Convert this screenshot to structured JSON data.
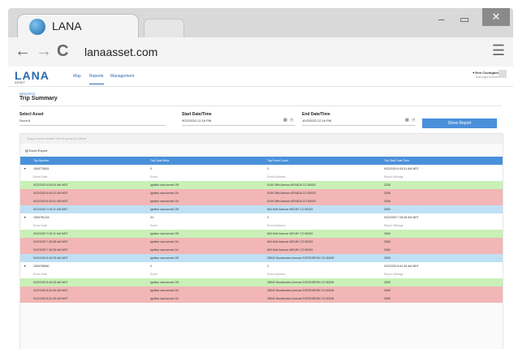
{
  "browser": {
    "tab_title": "LANA",
    "url": "lanaasset.com",
    "min": "–",
    "restore": "▭",
    "close": "✕",
    "back": "←",
    "forward": "→",
    "reload": "C",
    "menu": "☰"
  },
  "app": {
    "logo": "LANA",
    "logo_sub": "ASSET",
    "nav": [
      "Map",
      "Reports",
      "Management"
    ],
    "user_name": "▾ Erin Covington",
    "user_sub": "Manager/Admin"
  },
  "breadcrumb": "REPORTS",
  "page_title": "Trip Summary",
  "filters": {
    "asset_label": "Select Asset",
    "asset_value": "Drum A",
    "start_label": "Start Date/Time",
    "start_value": "9/22/2020 12:16 PM",
    "end_label": "End Date/Time",
    "end_value": "10/2/2020 12:16 PM",
    "show_button": "Show Report",
    "calendar_icon": "▦",
    "clock_icon": "◷"
  },
  "grid": {
    "group_hint": "Drag a column header here to group by column",
    "excel_label": "Excel Export",
    "headers": [
      "Trip Number",
      "Trip Total Miles",
      "Trip Event Count",
      "Trip Start Date Time"
    ],
    "sub_headers": [
      "Event Date",
      "Event",
      "Event Address",
      "Report Mileage"
    ],
    "trips": [
      {
        "number": "1500778631",
        "miles": "0",
        "count": "2",
        "start": "9/22/2020 6:43:31 AM MDT",
        "events": [
          {
            "date": "9/22/2020 6:00:00 AM MDT",
            "event": "Ignition was turned Off",
            "address": "5159 39th Avenue ARVADA CO 80003",
            "mileage": "3336",
            "status": "green"
          },
          {
            "date": "9/22/2020 6:43:31 AM MDT",
            "event": "Ignition was turned On",
            "address": "5159 39th Avenue ARVADA CO 80003",
            "mileage": "3336",
            "status": "red"
          },
          {
            "date": "9/22/2020 6:43:51 AM MDT",
            "event": "Ignition was turned On",
            "address": "5159 39th Avenue ARVADA CO 80003",
            "mileage": "3336",
            "status": "red"
          },
          {
            "date": "9/22/2020 7:03:11 AM MDT",
            "event": "Ignition was turned Off",
            "address": "663 64th Avenue WELBY CO 80229",
            "mileage": "3363",
            "status": "blue"
          }
        ]
      },
      {
        "number": "1500781215",
        "miles": "34",
        "count": "2",
        "start": "9/22/2020 7:28:35 AM MDT",
        "events": [
          {
            "date": "9/22/2020 7:03:11 AM MDT",
            "event": "Ignition was turned Off",
            "address": "663 64th Avenue WELBY CO 80229",
            "mileage": "3363",
            "status": "green"
          },
          {
            "date": "9/22/2020 7:28:35 AM MDT",
            "event": "Ignition was turned On",
            "address": "663 64th Avenue WELBY CO 80229",
            "mileage": "3363",
            "status": "red"
          },
          {
            "date": "9/22/2020 7:28:35 AM MDT",
            "event": "Ignition was turned On",
            "address": "663 64th Avenue WELBY CO 80229",
            "mileage": "3363",
            "status": "red"
          },
          {
            "date": "9/22/2020 8:18:33 AM MDT",
            "event": "Ignition was turned Off",
            "address": "28543 Wonderview Avenue EVERGREEN CO 80439",
            "mileage": "3399",
            "status": "blue"
          }
        ]
      },
      {
        "number": "1500785890",
        "miles": "0",
        "count": "2",
        "start": "9/22/2020 8:41:30 AM MDT",
        "events": [
          {
            "date": "9/22/2020 8:18:33 AM MDT",
            "event": "Ignition was turned Off",
            "address": "28543 Wonderview Avenue EVERGREEN CO 80439",
            "mileage": "3399",
            "status": "green"
          },
          {
            "date": "9/22/2020 8:41:30 AM MDT",
            "event": "Ignition was turned On",
            "address": "28543 Wonderview Avenue EVERGREEN CO 80439",
            "mileage": "3399",
            "status": "red"
          },
          {
            "date": "9/22/2020 8:41:30 AM MDT",
            "event": "Ignition was turned On",
            "address": "28543 Wonderview Avenue EVERGREEN CO 80439",
            "mileage": "3399",
            "status": "red"
          }
        ]
      }
    ]
  }
}
